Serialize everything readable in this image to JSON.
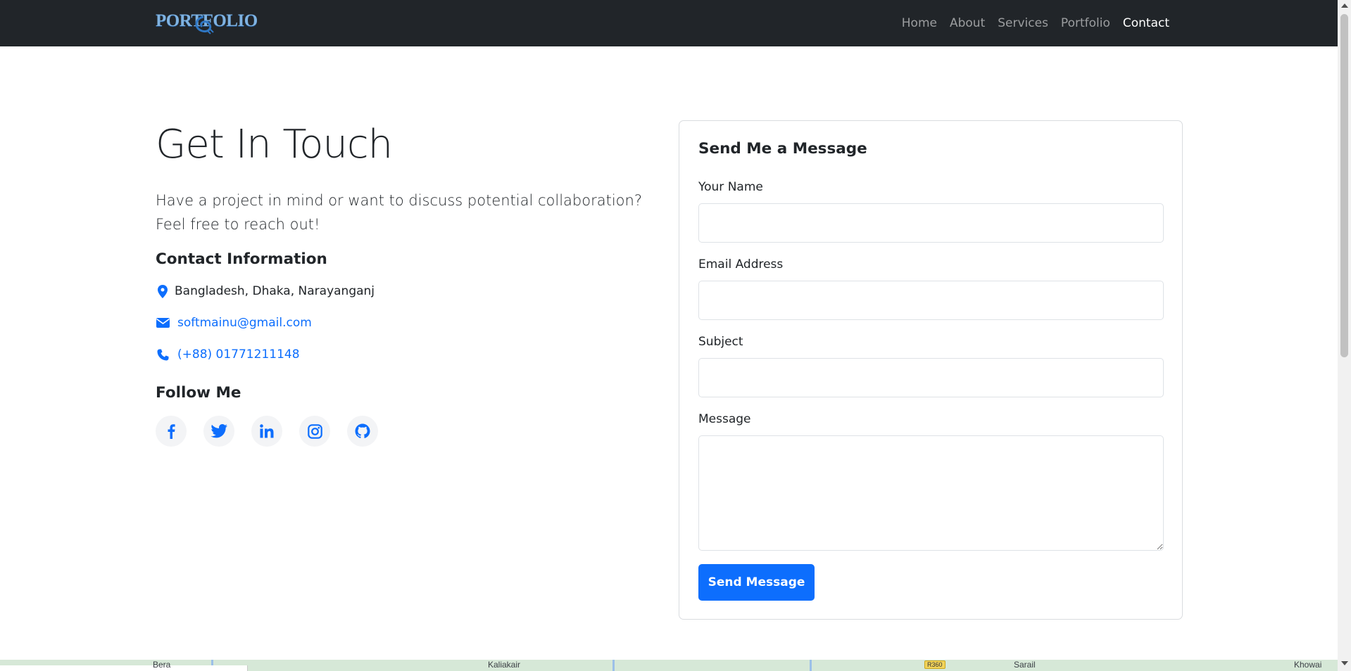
{
  "navbar": {
    "brand": "PORTFOLIO",
    "links": [
      {
        "label": "Home",
        "active": false
      },
      {
        "label": "About",
        "active": false
      },
      {
        "label": "Services",
        "active": false
      },
      {
        "label": "Portfolio",
        "active": false
      },
      {
        "label": "Contact",
        "active": true
      }
    ]
  },
  "contact": {
    "title": "Get In Touch",
    "lead": "Have a project in mind or want to discuss potential collaboration? Feel free to reach out!",
    "info_title": "Contact Information",
    "address": "Bangladesh, Dhaka, Narayanganj",
    "email": "softmainu@gmail.com",
    "phone": "(+88) 01771211148",
    "follow_title": "Follow Me",
    "socials": [
      "facebook-icon",
      "twitter-icon",
      "linkedin-icon",
      "instagram-icon",
      "github-icon"
    ]
  },
  "form": {
    "title": "Send Me a Message",
    "name_label": "Your Name",
    "name_value": "",
    "email_label": "Email Address",
    "email_value": "",
    "subject_label": "Subject",
    "subject_value": "",
    "message_label": "Message",
    "message_value": "",
    "submit_label": "Send Message"
  },
  "map": {
    "labels": [
      "Bera",
      "Kaliakair",
      "Sarail",
      "Khowai"
    ],
    "road_badge": "R360"
  },
  "colors": {
    "navbar_bg": "#212529",
    "primary": "#0d6efd",
    "text": "#212529"
  }
}
